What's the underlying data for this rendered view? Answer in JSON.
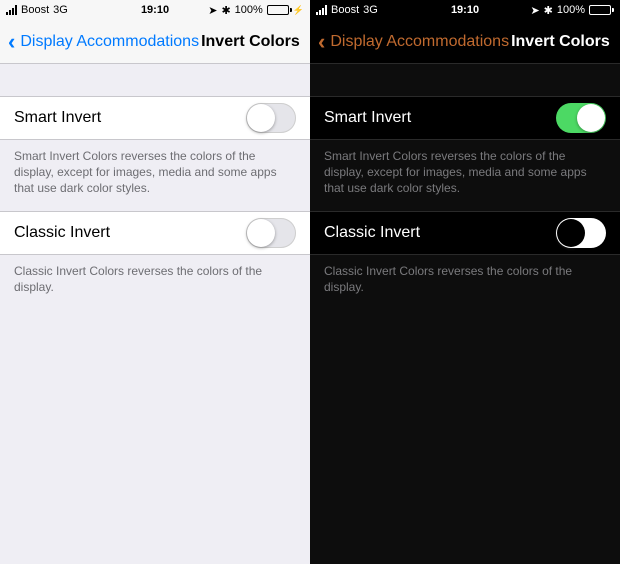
{
  "status": {
    "carrier": "Boost",
    "network": "3G",
    "time": "19:10",
    "battery_pct": "100%"
  },
  "nav": {
    "back_label": "Display Accommodations",
    "title": "Invert Colors"
  },
  "rows": {
    "smart": {
      "label": "Smart Invert",
      "note": "Smart Invert Colors reverses the colors of the display, except for images, media and some apps that use dark color styles."
    },
    "classic": {
      "label": "Classic Invert",
      "note": "Classic Invert Colors reverses the colors of the display."
    }
  },
  "light": {
    "smart_on": false,
    "classic_on": false
  },
  "dark": {
    "smart_on": true,
    "classic_on": false
  }
}
